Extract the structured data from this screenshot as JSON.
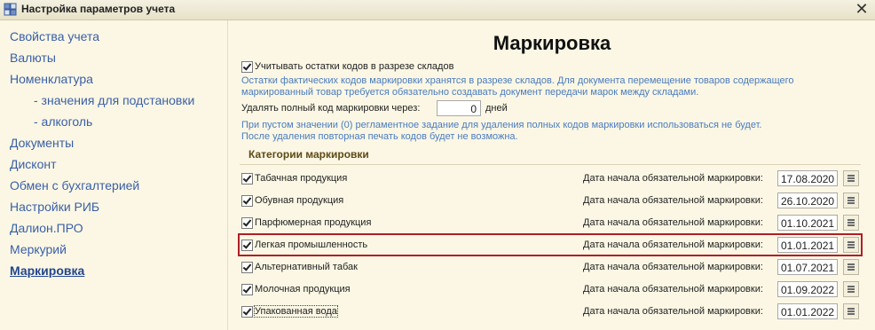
{
  "window": {
    "title": "Настройка параметров учета",
    "close_icon": "✕"
  },
  "sidebar": {
    "items": [
      {
        "label": "Свойства учета"
      },
      {
        "label": "Валюты"
      },
      {
        "label": "Номенклатура"
      },
      {
        "label": "- значения для подстановки"
      },
      {
        "label": "- алкоголь"
      },
      {
        "label": "Документы"
      },
      {
        "label": "Дисконт"
      },
      {
        "label": "Обмен с бухгалтерией"
      },
      {
        "label": "Настройки РИБ"
      },
      {
        "label": "Далион.ПРО"
      },
      {
        "label": "Меркурий"
      },
      {
        "label": "Маркировка"
      }
    ],
    "active": "Маркировка"
  },
  "main": {
    "heading": "Маркировка",
    "warehouse_checkbox_label": "Учитывать остатки кодов в разрезе складов",
    "warehouse_note_1": "Остатки фактических кодов маркировки хранятся в разрезе складов. Для документа перемещение товаров содержащего",
    "warehouse_note_2": "маркированный товар требуется обязательно создавать документ передачи марок между складами.",
    "delete_label": "Удалять полный код маркировки через:",
    "delete_value": "0",
    "delete_unit": "дней",
    "delete_note_1": "При пустом значении (0) регламентное задание для удаления полных кодов маркировки использоваться не будет.",
    "delete_note_2": "После удаления повторная печать кодов будет не возможна.",
    "section_title": "Категории маркировки",
    "date_caption": "Дата начала обязательной маркировки:",
    "categories": [
      {
        "name": "Табачная продукция",
        "checked": true,
        "date": "17.08.2020"
      },
      {
        "name": "Обувная продукция",
        "checked": true,
        "date": "26.10.2020"
      },
      {
        "name": "Парфюмерная продукция",
        "checked": true,
        "date": "01.10.2021"
      },
      {
        "name": "Легкая промышленность",
        "checked": true,
        "date": "01.01.2021"
      },
      {
        "name": "Альтернативный табак",
        "checked": true,
        "date": "01.07.2021"
      },
      {
        "name": "Молочная продукция",
        "checked": true,
        "date": "01.09.2022"
      },
      {
        "name": "Упакованная вода",
        "checked": true,
        "date": "01.01.2022"
      }
    ]
  },
  "colors": {
    "link": "#3a5fa8",
    "note": "#4a7bc0",
    "highlight": "#b01e28",
    "background": "#fbf7e4"
  }
}
